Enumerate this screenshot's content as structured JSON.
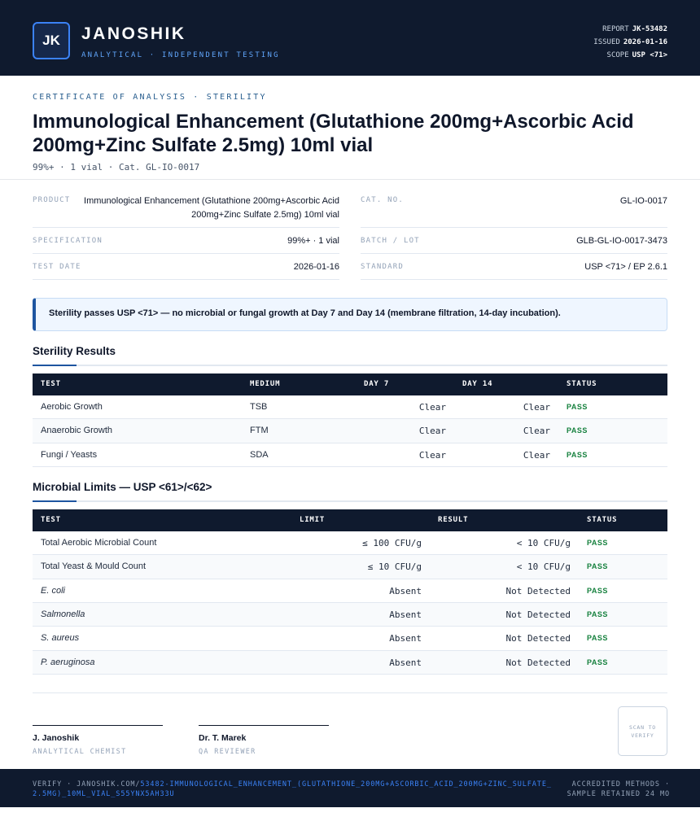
{
  "brand": {
    "logo": "JK",
    "name": "JANOSHIK",
    "tagline": "ANALYTICAL · INDEPENDENT TESTING"
  },
  "report_meta": {
    "report_label": "REPORT",
    "report_value": "JK-53482",
    "issued_label": "ISSUED",
    "issued_value": "2026-01-16",
    "scope_label": "SCOPE",
    "scope_value": "USP <71>"
  },
  "document": {
    "eyebrow": "CERTIFICATE OF ANALYSIS · STERILITY",
    "title": "Immunological Enhancement (Glutathione 200mg+Ascorbic Acid 200mg+Zinc Sulfate 2.5mg) 10ml vial",
    "subtitle": "99%+ · 1 vial  ·  Cat. GL-IO-0017"
  },
  "info": {
    "product_label": "PRODUCT",
    "product_value": "Immunological Enhancement (Glutathione 200mg+Ascorbic Acid 200mg+Zinc Sulfate 2.5mg) 10ml vial",
    "cat_label": "CAT. NO.",
    "cat_value": "GL-IO-0017",
    "spec_label": "SPECIFICATION",
    "spec_value": "99%+ · 1 vial",
    "batch_label": "BATCH / LOT",
    "batch_value": "GLB-GL-IO-0017-3473",
    "date_label": "TEST DATE",
    "date_value": "2026-01-16",
    "standard_label": "STANDARD",
    "standard_value": "USP <71> / EP 2.6.1"
  },
  "callout": "Sterility passes USP <71> — no microbial or fungal growth at Day 7 and Day 14 (membrane filtration, 14-day incubation).",
  "sterility": {
    "title": "Sterility Results",
    "headers": [
      "TEST",
      "MEDIUM",
      "DAY 7",
      "DAY 14",
      "STATUS"
    ],
    "rows": [
      {
        "test": "Aerobic Growth",
        "medium": "TSB",
        "day7": "Clear",
        "day14": "Clear",
        "status": "PASS"
      },
      {
        "test": "Anaerobic Growth",
        "medium": "FTM",
        "day7": "Clear",
        "day14": "Clear",
        "status": "PASS"
      },
      {
        "test": "Fungi / Yeasts",
        "medium": "SDA",
        "day7": "Clear",
        "day14": "Clear",
        "status": "PASS"
      }
    ]
  },
  "microbial": {
    "title": "Microbial Limits — USP <61>/<62>",
    "headers": [
      "TEST",
      "LIMIT",
      "RESULT",
      "STATUS"
    ],
    "rows": [
      {
        "test": "Total Aerobic Microbial Count",
        "limit": "≤ 100 CFU/g",
        "result": "< 10 CFU/g",
        "status": "PASS"
      },
      {
        "test": "Total Yeast & Mould Count",
        "limit": "≤ 10 CFU/g",
        "result": "< 10 CFU/g",
        "status": "PASS"
      },
      {
        "test": "E. coli",
        "limit": "Absent",
        "result": "Not Detected",
        "status": "PASS"
      },
      {
        "test": "Salmonella",
        "limit": "Absent",
        "result": "Not Detected",
        "status": "PASS"
      },
      {
        "test": "S. aureus",
        "limit": "Absent",
        "result": "Not Detected",
        "status": "PASS"
      },
      {
        "test": "P. aeruginosa",
        "limit": "Absent",
        "result": "Not Detected",
        "status": "PASS"
      }
    ]
  },
  "signatures": [
    {
      "name": "J. Janoshik",
      "role": "ANALYTICAL CHEMIST"
    },
    {
      "name": "Dr. T. Marek",
      "role": "QA REVIEWER"
    }
  ],
  "qr_text": "SCAN TO VERIFY",
  "footer": {
    "verify_prefix": "VERIFY · JANOSHIK.COM/",
    "verify_url": "53482-IMMUNOLOGICAL_ENHANCEMENT_(GLUTATHIONE_200MG+ASCORBIC_ACID_200MG+ZINC_SULFATE_2.5MG)_10ML_VIAL_S55YNX5AH33U",
    "right_text": "ACCREDITED METHODS · SAMPLE RETAINED 24 MO"
  }
}
